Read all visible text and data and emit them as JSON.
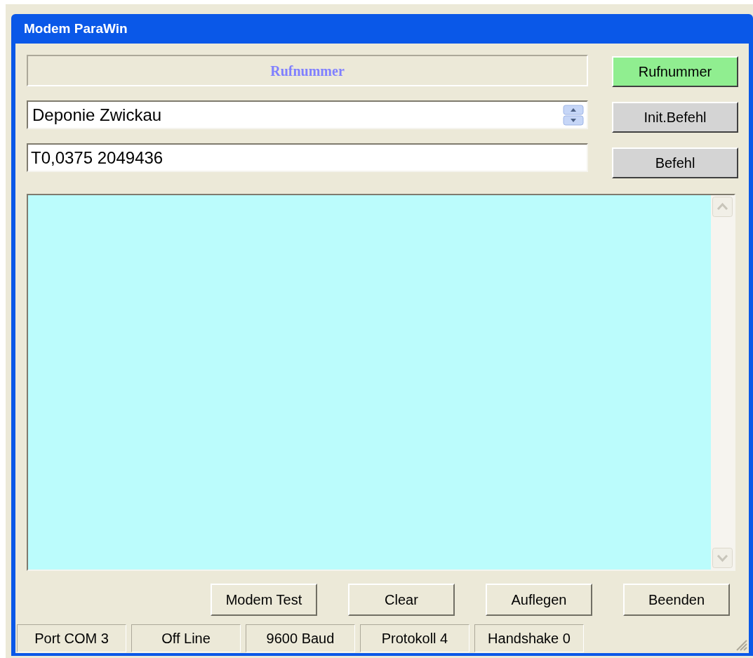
{
  "window": {
    "title": "Modem ParaWin"
  },
  "header_label": "Rufnummer",
  "name_combo": {
    "value": "Deponie Zwickau"
  },
  "command_field": {
    "value": "T0,0375 2049436"
  },
  "side_buttons": [
    {
      "label": "Rufnummer",
      "highlighted": true
    },
    {
      "label": "Init.Befehl",
      "highlighted": false
    },
    {
      "label": "Befehl",
      "highlighted": false
    }
  ],
  "bottom_buttons": [
    "Modem Test",
    "Clear",
    "Auflegen",
    "Beenden"
  ],
  "status_bar": [
    "Port COM 3",
    "Off Line",
    "9600 Baud",
    "Protokoll 4",
    "Handshake 0"
  ]
}
